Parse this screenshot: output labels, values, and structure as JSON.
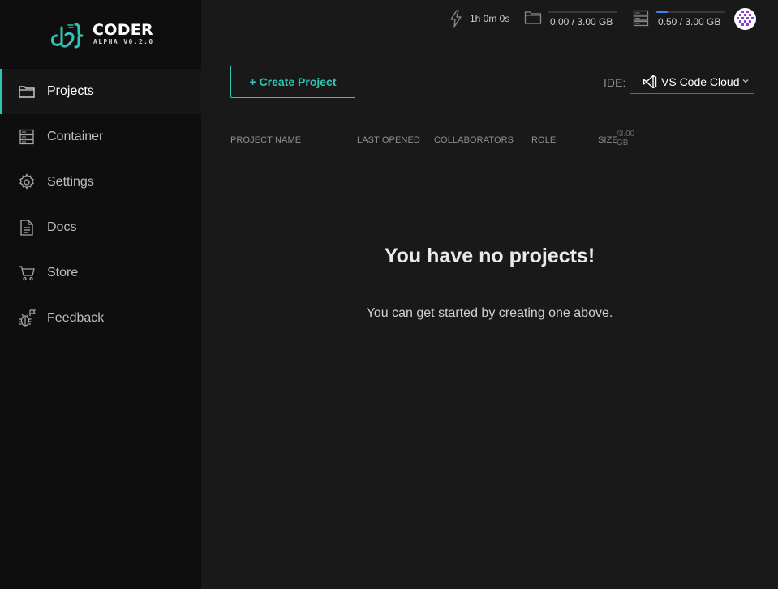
{
  "brand": {
    "name": "CODER",
    "version": "ALPHA V0.2.0"
  },
  "colors": {
    "accent": "#2fc5b4",
    "meter": "#3b82f6",
    "sidebar_bg": "#0e0e0e",
    "main_bg": "#191919"
  },
  "sidebar": {
    "items": [
      {
        "label": "Projects",
        "icon": "folder-icon",
        "active": true
      },
      {
        "label": "Container",
        "icon": "server-icon",
        "active": false
      },
      {
        "label": "Settings",
        "icon": "gear-icon",
        "active": false
      },
      {
        "label": "Docs",
        "icon": "document-icon",
        "active": false
      },
      {
        "label": "Store",
        "icon": "cart-icon",
        "active": false
      },
      {
        "label": "Feedback",
        "icon": "bug-icon",
        "active": false
      }
    ]
  },
  "topbar": {
    "timer": {
      "icon": "lightning-icon",
      "text": "1h 0m 0s"
    },
    "storage": {
      "icon": "folder-icon",
      "text": "0.00 / 3.00 GB",
      "used_fraction": 0.0
    },
    "container": {
      "icon": "server-icon",
      "text": "0.50 / 3.00 GB",
      "used_fraction": 0.167
    },
    "avatar": {
      "icon": "pixel-avatar-icon"
    }
  },
  "main": {
    "create_button": "+ Create Project",
    "ide": {
      "label": "IDE:",
      "value": "VS Code Cloud",
      "icon": "vscode-icon"
    },
    "table_headers": {
      "project_name": "PROJECT NAME",
      "last_opened": "LAST OPENED",
      "collaborators": "COLLABORATORS",
      "role": "ROLE",
      "size": "SIZE",
      "size_unit": "/3.00 GB"
    },
    "empty_title": "You have no projects!",
    "empty_subtitle": "You can get started by creating one above."
  }
}
